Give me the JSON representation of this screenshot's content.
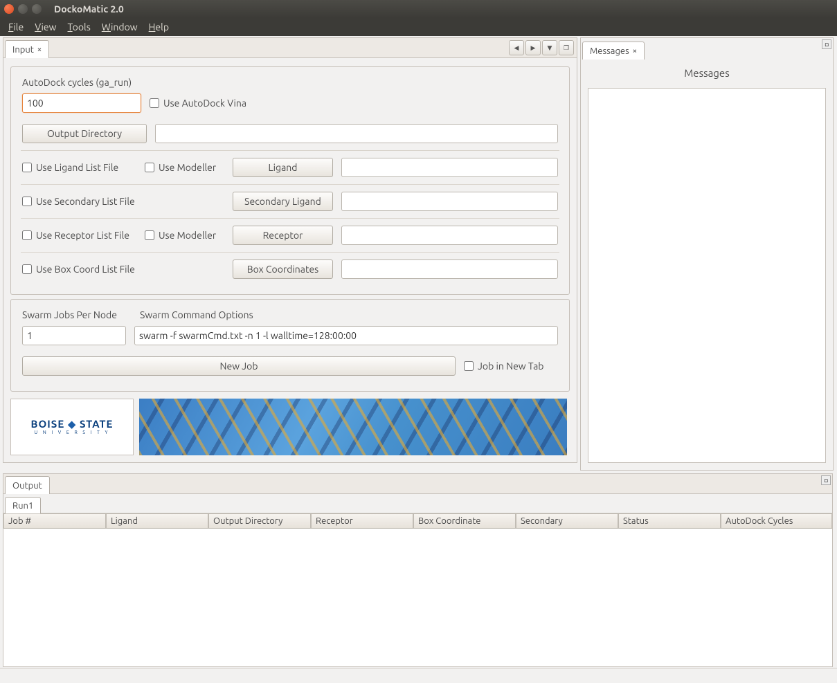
{
  "titlebar": {
    "title": "DockoMatic 2.0"
  },
  "menubar": {
    "file": "File",
    "view": "View",
    "tools": "Tools",
    "window": "Window",
    "help": "Help"
  },
  "input_tab": {
    "label": "Input"
  },
  "messages_tab": {
    "label": "Messages"
  },
  "messages_panel": {
    "heading": "Messages"
  },
  "form": {
    "autodock_label": "AutoDock cycles  (ga_run)",
    "autodock_value": "100",
    "use_vina": "Use AutoDock Vina",
    "output_dir_btn": "Output Directory",
    "output_dir_val": "",
    "use_ligand_list": "Use Ligand List File",
    "use_modeller": "Use Modeller",
    "ligand_btn": "Ligand",
    "ligand_val": "",
    "use_secondary_list": "Use Secondary List File",
    "secondary_btn": "Secondary Ligand",
    "secondary_val": "",
    "use_receptor_list": "Use Receptor List File",
    "receptor_btn": "Receptor",
    "receptor_val": "",
    "use_box_list": "Use Box Coord List File",
    "box_btn": "Box Coordinates",
    "box_val": "",
    "swarm_jobs_label": "Swarm Jobs Per Node",
    "swarm_jobs_val": "1",
    "swarm_cmd_label": "Swarm Command Options",
    "swarm_cmd_val": "swarm -f swarmCmd.txt -n 1 -l walltime=128:00:00",
    "new_job_btn": "New Job",
    "job_new_tab": "Job in New Tab"
  },
  "logo": {
    "line1": "BOISE",
    "line2": "STATE",
    "sub": "U N I V E R S I T Y"
  },
  "output": {
    "tab": "Output",
    "subtab": "Run1",
    "columns": {
      "job": "Job #",
      "ligand": "Ligand",
      "outdir": "Output Directory",
      "receptor": "Receptor",
      "box": "Box Coordinate",
      "secondary": "Secondary",
      "status": "Status",
      "cycles": "AutoDock Cycles"
    }
  }
}
